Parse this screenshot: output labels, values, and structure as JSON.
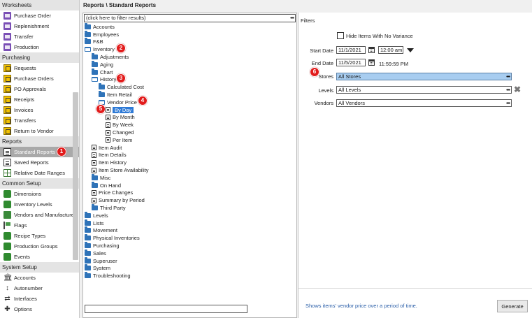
{
  "sidebar": {
    "sections": [
      {
        "title": "Worksheets",
        "items": [
          {
            "label": "Purchase Order",
            "icon": "purchase-order-icon"
          },
          {
            "label": "Replenishment",
            "icon": "replenishment-icon"
          },
          {
            "label": "Transfer",
            "icon": "transfer-icon"
          },
          {
            "label": "Production",
            "icon": "production-icon"
          }
        ]
      },
      {
        "title": "Purchasing",
        "items": [
          {
            "label": "Requests",
            "icon": "requests-icon"
          },
          {
            "label": "Purchase Orders",
            "icon": "purchase-orders-icon"
          },
          {
            "label": "PO Approvals",
            "icon": "po-approvals-icon"
          },
          {
            "label": "Receipts",
            "icon": "receipts-icon"
          },
          {
            "label": "Invoices",
            "icon": "invoices-icon"
          },
          {
            "label": "Transfers",
            "icon": "transfers-icon"
          },
          {
            "label": "Return to Vendor",
            "icon": "return-to-vendor-icon"
          }
        ]
      },
      {
        "title": "Reports",
        "items": [
          {
            "label": "Standard Reports",
            "icon": "standard-reports-icon"
          },
          {
            "label": "Saved Reports",
            "icon": "saved-reports-icon"
          },
          {
            "label": "Relative Date Ranges",
            "icon": "relative-date-ranges-icon"
          }
        ]
      },
      {
        "title": "Common Setup",
        "items": [
          {
            "label": "Dimensions",
            "icon": "dimensions-icon"
          },
          {
            "label": "Inventory Levels",
            "icon": "inventory-levels-icon"
          },
          {
            "label": "Vendors and Manufacturers",
            "icon": "vendors-icon"
          },
          {
            "label": "Flags",
            "icon": "flags-icon"
          },
          {
            "label": "Recipe Types",
            "icon": "recipe-types-icon"
          },
          {
            "label": "Production Groups",
            "icon": "production-groups-icon"
          },
          {
            "label": "Events",
            "icon": "events-icon"
          }
        ]
      },
      {
        "title": "System Setup",
        "items": [
          {
            "label": "Accounts",
            "icon": "accounts-icon"
          },
          {
            "label": "Autonumber",
            "icon": "autonumber-icon"
          },
          {
            "label": "Interfaces",
            "icon": "interfaces-icon"
          },
          {
            "label": "Options",
            "icon": "options-icon"
          }
        ]
      }
    ]
  },
  "breadcrumb": "Reports \\ Standard Reports",
  "tree": {
    "filter_placeholder": "(click here to filter results)",
    "filter_button": "•••",
    "nodes": [
      {
        "label": "Accounts",
        "depth": 0,
        "type": "folder"
      },
      {
        "label": "Employees",
        "depth": 0,
        "type": "folder"
      },
      {
        "label": "F&B",
        "depth": 0,
        "type": "folder"
      },
      {
        "label": "Inventory",
        "depth": 0,
        "type": "open"
      },
      {
        "label": "Adjustments",
        "depth": 1,
        "type": "folder"
      },
      {
        "label": "Aging",
        "depth": 1,
        "type": "folder"
      },
      {
        "label": "Chart",
        "depth": 1,
        "type": "folder"
      },
      {
        "label": "History",
        "depth": 1,
        "type": "open"
      },
      {
        "label": "Calculated Cost",
        "depth": 2,
        "type": "folder"
      },
      {
        "label": "Item Retail",
        "depth": 2,
        "type": "folder"
      },
      {
        "label": "Vendor Price",
        "depth": 2,
        "type": "open"
      },
      {
        "label": "By Day",
        "depth": 3,
        "type": "doc",
        "selected": true
      },
      {
        "label": "By Month",
        "depth": 3,
        "type": "doc"
      },
      {
        "label": "By Week",
        "depth": 3,
        "type": "doc"
      },
      {
        "label": "Changed",
        "depth": 3,
        "type": "doc"
      },
      {
        "label": "Per Item",
        "depth": 3,
        "type": "doc"
      },
      {
        "label": "Item Audit",
        "depth": 1,
        "type": "doc"
      },
      {
        "label": "Item Details",
        "depth": 1,
        "type": "doc"
      },
      {
        "label": "Item History",
        "depth": 1,
        "type": "doc"
      },
      {
        "label": "Item Store Availability",
        "depth": 1,
        "type": "doc"
      },
      {
        "label": "Misc",
        "depth": 1,
        "type": "folder"
      },
      {
        "label": "On Hand",
        "depth": 1,
        "type": "folder"
      },
      {
        "label": "Price Changes",
        "depth": 1,
        "type": "doc"
      },
      {
        "label": "Summary by Period",
        "depth": 1,
        "type": "doc"
      },
      {
        "label": "Third Party",
        "depth": 1,
        "type": "folder"
      },
      {
        "label": "Levels",
        "depth": 0,
        "type": "folder"
      },
      {
        "label": "Lists",
        "depth": 0,
        "type": "folder"
      },
      {
        "label": "Movement",
        "depth": 0,
        "type": "folder"
      },
      {
        "label": "Physical Inventories",
        "depth": 0,
        "type": "folder"
      },
      {
        "label": "Purchasing",
        "depth": 0,
        "type": "folder"
      },
      {
        "label": "Sales",
        "depth": 0,
        "type": "folder"
      },
      {
        "label": "Superuser",
        "depth": 0,
        "type": "folder"
      },
      {
        "label": "System",
        "depth": 0,
        "type": "folder"
      },
      {
        "label": "Troubleshooting",
        "depth": 0,
        "type": "folder"
      }
    ]
  },
  "filters": {
    "title": "Filters",
    "hide_no_variance": {
      "label": "Hide Items With No Variance",
      "checked": false
    },
    "start_date": {
      "label": "Start Date",
      "date": "11/1/2021",
      "time": "12:00 am"
    },
    "end_date": {
      "label": "End Date",
      "date": "11/5/2021",
      "time": "11:59:59 PM"
    },
    "stores": {
      "label": "Stores",
      "value": "All Stores"
    },
    "levels": {
      "label": "Levels",
      "value": "All Levels"
    },
    "vendors": {
      "label": "Vendors",
      "value": "All Vendors"
    },
    "dots": "•••",
    "description": "Shows items' vendor price over a period of time.",
    "generate_label": "Generate"
  },
  "badges": [
    {
      "n": "1",
      "target": "standard-reports"
    },
    {
      "n": "2",
      "target": "inventory"
    },
    {
      "n": "3",
      "target": "history"
    },
    {
      "n": "4",
      "target": "vendor-price"
    },
    {
      "n": "5",
      "target": "by-day"
    },
    {
      "n": "6",
      "target": "stores"
    }
  ],
  "colors": {
    "badge": "#e21b1b",
    "selected_node": "#2e7ad6",
    "stores_highlight": "#a8cdf0",
    "folder": "#2f73b8",
    "description_text": "#2a5ea8"
  }
}
